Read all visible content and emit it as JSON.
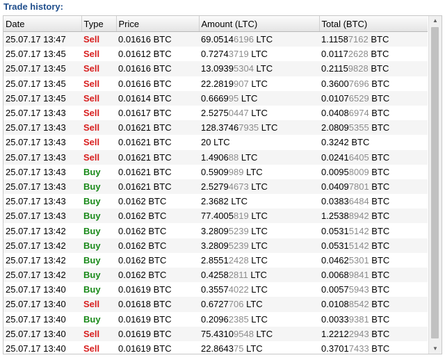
{
  "title": "Trade history:",
  "columns": [
    "Date",
    "Type",
    "Price",
    "Amount (LTC)",
    "Total (BTC)"
  ],
  "rows": [
    {
      "date": "25.07.17 13:47",
      "type": "Sell",
      "price": "0.01616 BTC",
      "amount_main": "69.0514",
      "amount_dim": "6196",
      "amount_unit": " LTC",
      "total_main": "1.1158",
      "total_dim": "7162",
      "total_unit": " BTC"
    },
    {
      "date": "25.07.17 13:45",
      "type": "Sell",
      "price": "0.01612 BTC",
      "amount_main": "0.7274",
      "amount_dim": "3719",
      "amount_unit": " LTC",
      "total_main": "0.0117",
      "total_dim": "2628",
      "total_unit": " BTC"
    },
    {
      "date": "25.07.17 13:45",
      "type": "Sell",
      "price": "0.01616 BTC",
      "amount_main": "13.0939",
      "amount_dim": "5304",
      "amount_unit": " LTC",
      "total_main": "0.2115",
      "total_dim": "9828",
      "total_unit": " BTC"
    },
    {
      "date": "25.07.17 13:45",
      "type": "Sell",
      "price": "0.01616 BTC",
      "amount_main": "22.2819",
      "amount_dim": "907",
      "amount_unit": " LTC",
      "total_main": "0.3600",
      "total_dim": "7696",
      "total_unit": " BTC"
    },
    {
      "date": "25.07.17 13:45",
      "type": "Sell",
      "price": "0.01614 BTC",
      "amount_main": "0.6669",
      "amount_dim": "95",
      "amount_unit": " LTC",
      "total_main": "0.0107",
      "total_dim": "6529",
      "total_unit": " BTC"
    },
    {
      "date": "25.07.17 13:43",
      "type": "Sell",
      "price": "0.01617 BTC",
      "amount_main": "2.5275",
      "amount_dim": "0447",
      "amount_unit": " LTC",
      "total_main": "0.0408",
      "total_dim": "6974",
      "total_unit": " BTC"
    },
    {
      "date": "25.07.17 13:43",
      "type": "Sell",
      "price": "0.01621 BTC",
      "amount_main": "128.3746",
      "amount_dim": "7935",
      "amount_unit": " LTC",
      "total_main": "2.0809",
      "total_dim": "5355",
      "total_unit": " BTC"
    },
    {
      "date": "25.07.17 13:43",
      "type": "Sell",
      "price": "0.01621 BTC",
      "amount_main": "20",
      "amount_dim": "",
      "amount_unit": " LTC",
      "total_main": "0.3242",
      "total_dim": "",
      "total_unit": " BTC"
    },
    {
      "date": "25.07.17 13:43",
      "type": "Sell",
      "price": "0.01621 BTC",
      "amount_main": "1.4906",
      "amount_dim": "88",
      "amount_unit": " LTC",
      "total_main": "0.0241",
      "total_dim": "6405",
      "total_unit": " BTC"
    },
    {
      "date": "25.07.17 13:43",
      "type": "Buy",
      "price": "0.01621 BTC",
      "amount_main": "0.5909",
      "amount_dim": "989",
      "amount_unit": " LTC",
      "total_main": "0.0095",
      "total_dim": "8009",
      "total_unit": " BTC"
    },
    {
      "date": "25.07.17 13:43",
      "type": "Buy",
      "price": "0.01621 BTC",
      "amount_main": "2.5279",
      "amount_dim": "4673",
      "amount_unit": " LTC",
      "total_main": "0.0409",
      "total_dim": "7801",
      "total_unit": " BTC"
    },
    {
      "date": "25.07.17 13:43",
      "type": "Buy",
      "price": "0.0162 BTC",
      "amount_main": "2.3682",
      "amount_dim": "",
      "amount_unit": " LTC",
      "total_main": "0.0383",
      "total_dim": "6484",
      "total_unit": " BTC"
    },
    {
      "date": "25.07.17 13:43",
      "type": "Buy",
      "price": "0.0162 BTC",
      "amount_main": "77.4005",
      "amount_dim": "819",
      "amount_unit": " LTC",
      "total_main": "1.2538",
      "total_dim": "8942",
      "total_unit": " BTC"
    },
    {
      "date": "25.07.17 13:42",
      "type": "Buy",
      "price": "0.0162 BTC",
      "amount_main": "3.2809",
      "amount_dim": "5239",
      "amount_unit": " LTC",
      "total_main": "0.0531",
      "total_dim": "5142",
      "total_unit": " BTC"
    },
    {
      "date": "25.07.17 13:42",
      "type": "Buy",
      "price": "0.0162 BTC",
      "amount_main": "3.2809",
      "amount_dim": "5239",
      "amount_unit": " LTC",
      "total_main": "0.0531",
      "total_dim": "5142",
      "total_unit": " BTC"
    },
    {
      "date": "25.07.17 13:42",
      "type": "Buy",
      "price": "0.0162 BTC",
      "amount_main": "2.8551",
      "amount_dim": "2428",
      "amount_unit": " LTC",
      "total_main": "0.0462",
      "total_dim": "5301",
      "total_unit": " BTC"
    },
    {
      "date": "25.07.17 13:42",
      "type": "Buy",
      "price": "0.0162 BTC",
      "amount_main": "0.4258",
      "amount_dim": "2811",
      "amount_unit": " LTC",
      "total_main": "0.0068",
      "total_dim": "9841",
      "total_unit": " BTC"
    },
    {
      "date": "25.07.17 13:40",
      "type": "Buy",
      "price": "0.01619 BTC",
      "amount_main": "0.3557",
      "amount_dim": "4022",
      "amount_unit": " LTC",
      "total_main": "0.0057",
      "total_dim": "5943",
      "total_unit": " BTC"
    },
    {
      "date": "25.07.17 13:40",
      "type": "Sell",
      "price": "0.01618 BTC",
      "amount_main": "0.6727",
      "amount_dim": "706",
      "amount_unit": " LTC",
      "total_main": "0.0108",
      "total_dim": "8542",
      "total_unit": " BTC"
    },
    {
      "date": "25.07.17 13:40",
      "type": "Buy",
      "price": "0.01619 BTC",
      "amount_main": "0.2096",
      "amount_dim": "2385",
      "amount_unit": " LTC",
      "total_main": "0.0033",
      "total_dim": "9381",
      "total_unit": " BTC"
    },
    {
      "date": "25.07.17 13:40",
      "type": "Sell",
      "price": "0.01619 BTC",
      "amount_main": "75.4310",
      "amount_dim": "9548",
      "amount_unit": " LTC",
      "total_main": "1.2212",
      "total_dim": "2943",
      "total_unit": " BTC"
    },
    {
      "date": "25.07.17 13:40",
      "type": "Sell",
      "price": "0.01619 BTC",
      "amount_main": "22.8643",
      "amount_dim": "75",
      "amount_unit": " LTC",
      "total_main": "0.3701",
      "total_dim": "7433",
      "total_unit": " BTC"
    }
  ],
  "colors": {
    "sell": "#d81e1e",
    "buy": "#1a8a1a",
    "title": "#1f4e8c"
  },
  "icons": {
    "scroll_up": "up-arrow-icon",
    "scroll_down": "down-arrow-icon"
  }
}
